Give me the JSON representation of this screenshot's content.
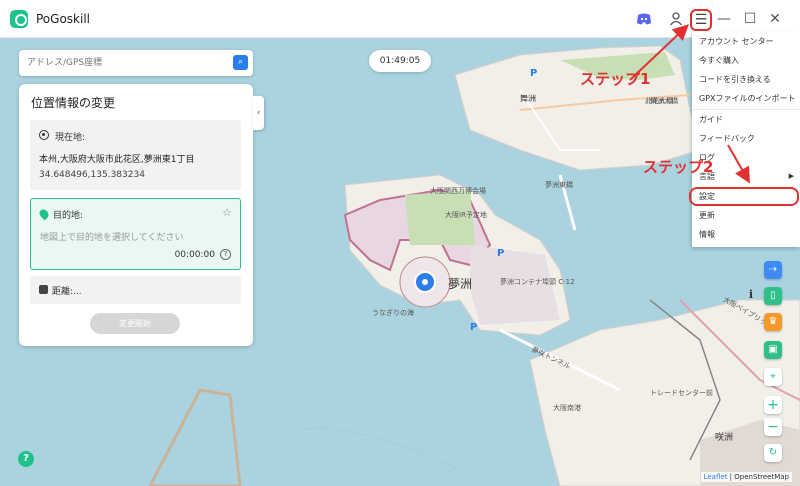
{
  "app": {
    "title": "PoGoskill"
  },
  "titlebar": {
    "icons": [
      "discord-icon",
      "user-icon",
      "menu-icon",
      "minimize-icon",
      "maximize-icon",
      "close-icon"
    ]
  },
  "search": {
    "placeholder": "アドレス/GPS座標"
  },
  "timer": {
    "value": "01:49:05"
  },
  "panel": {
    "title": "位置情報の変更",
    "current": {
      "label": "現在地:",
      "address": "本州,大阪府大阪市此花区,夢洲東1丁目",
      "coords": "34.648496,135.383234"
    },
    "destination": {
      "label": "目的地:",
      "hint": "地図上で目的地を選択してください",
      "time": "00:00:00"
    },
    "distance": {
      "label": "距離:..."
    },
    "start_button": "変更開始"
  },
  "menu": {
    "items": [
      "アカウント センター",
      "今すぐ購入",
      "コードを引き換える",
      "GPXファイルのインポート",
      "ガイド",
      "フィードバック",
      "ログ",
      "言語",
      "設定",
      "更新",
      "情報"
    ],
    "highlighted": "設定"
  },
  "annotations": {
    "step1": "ステップ1",
    "step2": "ステップ2"
  },
  "map": {
    "labels": {
      "l1": "夢洲",
      "l2": "夢洲東橋",
      "l3": "舞洲",
      "l4": "舞洲大橋",
      "l5": "此花大橋",
      "l6": "夢咲トンネル",
      "l7": "大阪関西万博会場",
      "l8": "大阪IR予定地",
      "l9": "夢洲コンテナ埠頭 C-12",
      "l10": "うなぎりの海",
      "l11": "大阪南港",
      "l12": "トレードセンター前",
      "l13": "咲洲",
      "l14": "大阪ベイブリッジ",
      "l15": "P",
      "l16": "P",
      "l17": "P"
    },
    "attribution": {
      "leaflet": "Leaflet",
      "rest": "| OpenStreetMap"
    }
  },
  "colors": {
    "water": "#aad3df",
    "land": "#f2efe9",
    "accent": "#1fc28b",
    "annotation": "#e03030"
  }
}
